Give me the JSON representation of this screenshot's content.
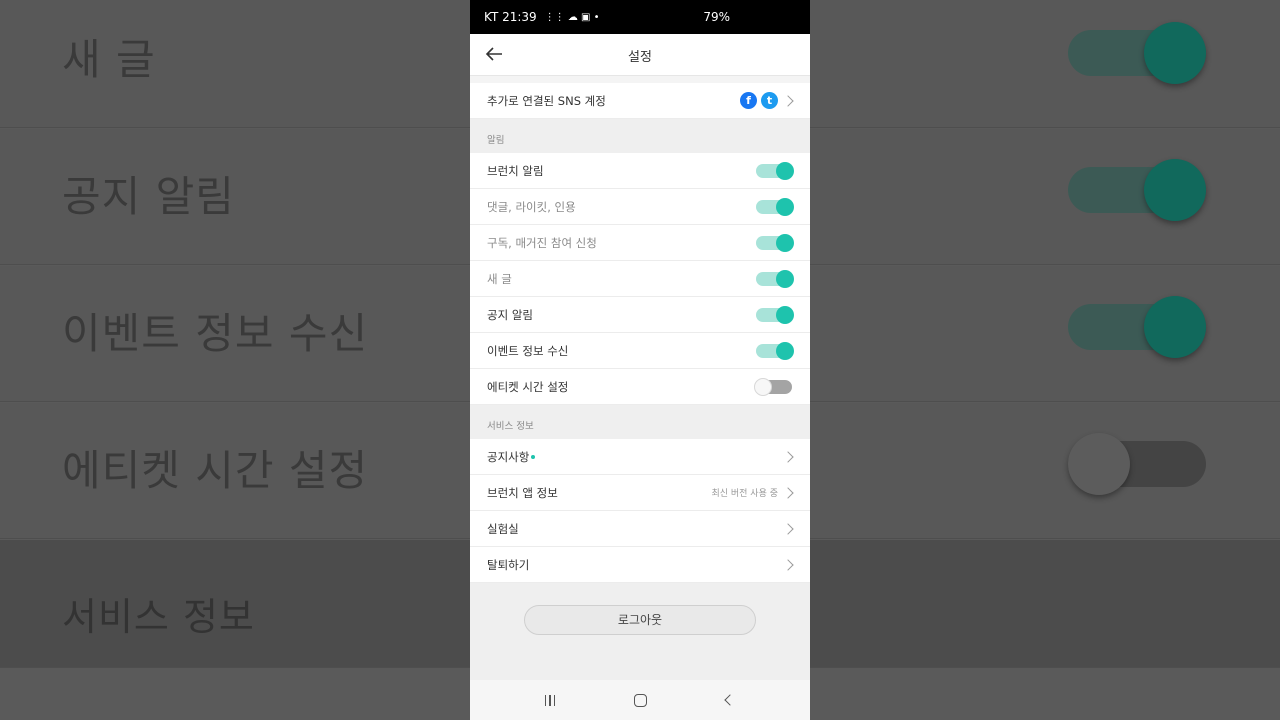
{
  "background": {
    "rows": [
      {
        "label": "새 글",
        "toggle": "on"
      },
      {
        "label": "공지 알림",
        "toggle": "on"
      },
      {
        "label": "이벤트 정보 수신",
        "toggle": "on"
      },
      {
        "label": "에티켓 시간 설정",
        "toggle": "off"
      },
      {
        "label": "서비스 정보",
        "toggle": "none"
      }
    ]
  },
  "status_bar": {
    "left": "KT 21:39",
    "right": "79%"
  },
  "app_bar": {
    "title": "설정"
  },
  "sns": {
    "label": "추가로 연결된 SNS 계정",
    "icons": [
      "facebook-icon",
      "twitter-icon"
    ]
  },
  "notifications": {
    "header": "알림",
    "items": [
      {
        "label": "브런치 알림",
        "on": true
      },
      {
        "label": "댓글, 라이킷, 인용",
        "on": true
      },
      {
        "label": "구독, 매거진 참여 신청",
        "on": true
      },
      {
        "label": "새 글",
        "on": true
      },
      {
        "label": "공지 알림",
        "on": true
      },
      {
        "label": "이벤트 정보 수신",
        "on": true
      },
      {
        "label": "에티켓 시간 설정",
        "on": false
      }
    ]
  },
  "service": {
    "header": "서비스 정보",
    "items": [
      {
        "label": "공지사항",
        "sub": ""
      },
      {
        "label": "브런치 앱 정보",
        "sub": "최신 버전 사용 중"
      },
      {
        "label": "실험실",
        "sub": ""
      },
      {
        "label": "탈퇴하기",
        "sub": ""
      }
    ]
  },
  "logout": {
    "label": "로그아웃"
  },
  "colors": {
    "accent": "#1ec3ad",
    "accent_track": "#a8e3d9",
    "facebook": "#1877f2",
    "twitter": "#1d9bf0"
  }
}
